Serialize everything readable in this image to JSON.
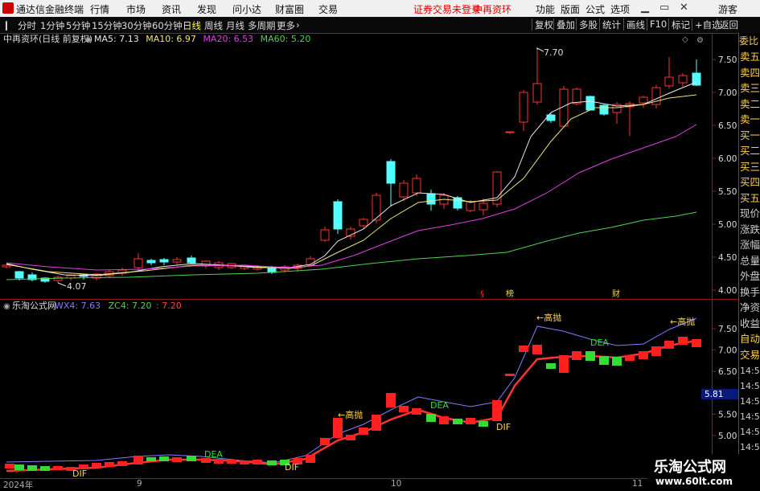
{
  "titlebar": {
    "app_name": "通达信金融终端",
    "menu": [
      "行情",
      "市场",
      "资讯",
      "发现",
      "问小达",
      "财富圈",
      "交易"
    ],
    "warning": "证券交易未登录",
    "stock_name": "中再资环",
    "right_menu": [
      "功能",
      "版面",
      "公式",
      "选项"
    ],
    "user": "游客"
  },
  "toolbar": {
    "periods": [
      "分时",
      "1分钟",
      "5分钟",
      "15分钟",
      "30分钟",
      "60分钟",
      "日线",
      "周线",
      "月线",
      "多周期",
      "更多"
    ],
    "active_period": "日线",
    "right_buttons": [
      "复权",
      "叠加",
      "多股",
      "统计",
      "画线",
      "F10",
      "标记",
      "+自选",
      "返回"
    ]
  },
  "main_chart": {
    "header_title": "中再资环(日线 前复权)",
    "ma": [
      {
        "label": "MA5: 7.13",
        "color": "#e8e8e8"
      },
      {
        "label": "MA10: 6.97",
        "color": "#f2e27a"
      },
      {
        "label": "MA20: 6.53",
        "color": "#e040e0"
      },
      {
        "label": "MA60: 5.20",
        "color": "#4fd24f"
      }
    ],
    "y_ticks": [
      "7.50",
      "7.00",
      "6.50",
      "6.00",
      "5.50",
      "5.00",
      "4.50",
      "4.00"
    ],
    "high_label": "7.70",
    "low_label": "4.07",
    "markers": [
      "§",
      "榜",
      "财"
    ]
  },
  "sub_chart": {
    "header_title": "乐淘公式网",
    "indicators": [
      {
        "label": "WX4: 7.63",
        "color": "#7d7dff"
      },
      {
        "label": "ZC4: 7.20",
        "color": "#4fd24f"
      },
      {
        "label": ": 7.20",
        "color": "#ff4040"
      }
    ],
    "y_ticks": [
      "7.50",
      "7.00",
      "6.50",
      "6.00",
      "5.50",
      "5.00"
    ],
    "tag_value": "5.81",
    "annotations": {
      "gao_pao": "←高抛",
      "dea": "DEA",
      "dif": "DIF"
    }
  },
  "x_axis": {
    "labels": [
      "2024年",
      "9",
      "10",
      "11"
    ]
  },
  "right_column": {
    "top_label": "委比",
    "items": [
      "委比",
      "卖五",
      "卖四",
      "卖三",
      "卖二",
      "卖一",
      "买一",
      "买二",
      "买三",
      "买四",
      "买五",
      "现价",
      "涨跌",
      "涨幅",
      "总量",
      "外盘",
      "换手",
      "净资",
      "收益",
      "自动",
      "交易"
    ],
    "times": [
      "14:56",
      "14:56",
      "14:56",
      "14:56",
      "14:56",
      "14:56",
      "14:56",
      "14:56",
      "14:56"
    ]
  },
  "watermark": {
    "line1": "乐淘公式网",
    "line2": "www.60lt.com"
  },
  "colors": {
    "up": "#ff3333",
    "down": "#54ffff",
    "ma5": "#e8e8e8",
    "ma10": "#f2e27a",
    "ma20": "#e040e0",
    "ma60": "#4fd24f",
    "wx": "#7d7dff",
    "dea": "#ff3333",
    "frame": "#8a1d1d"
  }
}
